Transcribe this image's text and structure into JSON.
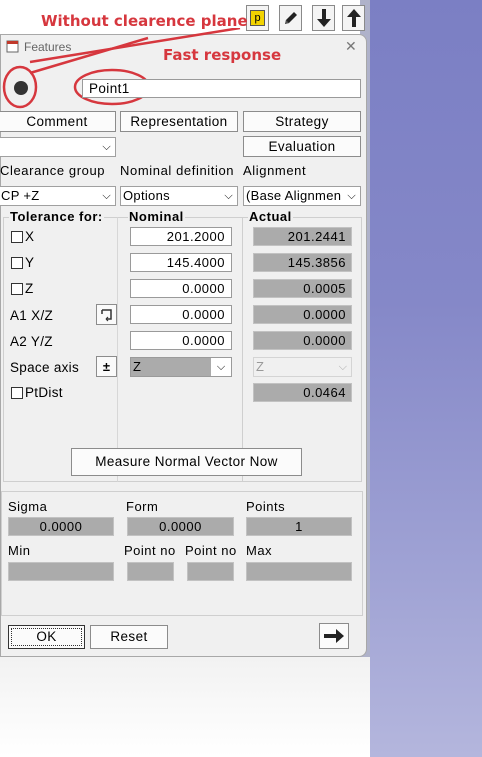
{
  "annotations": {
    "clearance_note": "Without clearence plane",
    "response_note": "Fast response"
  },
  "toolbar": {
    "p_label": "p"
  },
  "window": {
    "title": "Features",
    "close_glyph": "✕"
  },
  "feature_name": "Point1",
  "buttons": {
    "comment": "Comment",
    "representation": "Representation",
    "strategy": "Strategy",
    "evaluation": "Evaluation",
    "measure_normal": "Measure Normal Vector Now",
    "ok": "OK",
    "reset": "Reset"
  },
  "headers": {
    "clearance_group": "Clearance group",
    "nominal_definition": "Nominal definition",
    "alignment": "Alignment",
    "tolerance_for": "Tolerance for:",
    "nominal": "Nominal",
    "actual": "Actual"
  },
  "selects": {
    "clearance": "CP +Z",
    "nominal_def": "Options",
    "alignment": "(Base Alignmen"
  },
  "rows": {
    "x": {
      "label": "X",
      "nominal": "201.2000",
      "actual": "201.2441"
    },
    "y": {
      "label": "Y",
      "nominal": "145.4000",
      "actual": "145.3856"
    },
    "z": {
      "label": "Z",
      "nominal": "0.0000",
      "actual": "0.0005"
    },
    "a1": {
      "label": "A1 X/Z",
      "nominal": "0.0000",
      "actual": "0.0000"
    },
    "a2": {
      "label": "A2 Y/Z",
      "nominal": "0.0000",
      "actual": "0.0000"
    }
  },
  "space_axis": {
    "label": "Space axis",
    "plusminus": "±",
    "nominal": "Z",
    "actual": "Z"
  },
  "ptdist": {
    "label": "PtDist",
    "actual": "0.0464"
  },
  "stats": {
    "sigma_label": "Sigma",
    "sigma": "0.0000",
    "form_label": "Form",
    "form": "0.0000",
    "points_label": "Points",
    "points": "1",
    "min_label": "Min",
    "pointno1_label": "Point no",
    "pointno2_label": "Point no",
    "max_label": "Max"
  },
  "colors": {
    "annotation": "#d6373e",
    "background_gradient": "#8588c8"
  }
}
